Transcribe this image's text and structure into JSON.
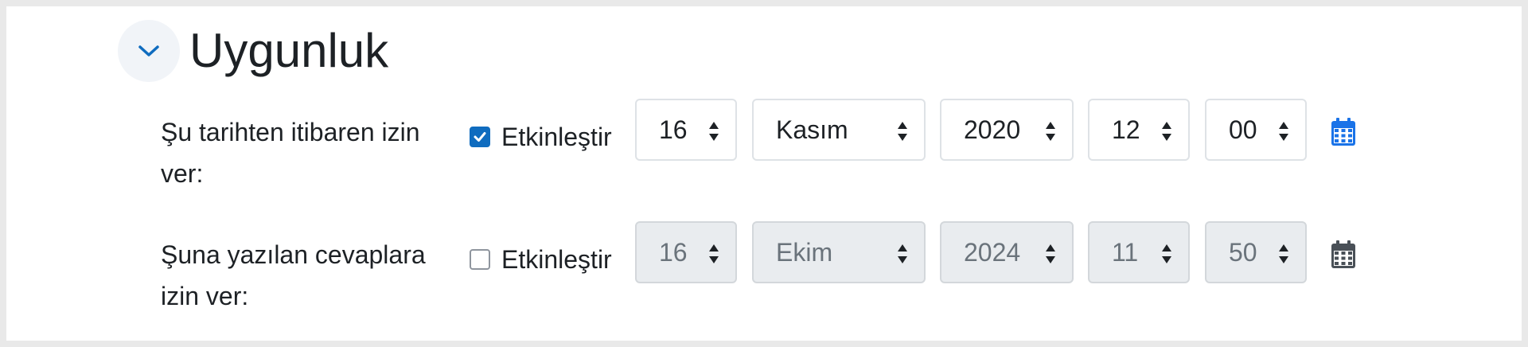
{
  "section": {
    "title": "Uygunluk"
  },
  "rows": [
    {
      "label": "Şu tarihten itibaren izin ver:",
      "enable_label": "Etkinleştir",
      "enabled": true,
      "day": "16",
      "month": "Kasım",
      "year": "2020",
      "hour": "12",
      "minute": "00"
    },
    {
      "label": "Şuna yazılan cevaplara izin ver:",
      "enable_label": "Etkinleştir",
      "enabled": false,
      "day": "16",
      "month": "Ekim",
      "year": "2024",
      "hour": "11",
      "minute": "50"
    }
  ],
  "colors": {
    "accent": "#0f6cbf",
    "calendar_active": "#1a73e8",
    "calendar_disabled": "#495057",
    "disabled_bg": "#e9ecef"
  },
  "icons": {
    "collapse": "chevron-down-icon",
    "checked": "check-icon",
    "calendar": "calendar-icon"
  }
}
